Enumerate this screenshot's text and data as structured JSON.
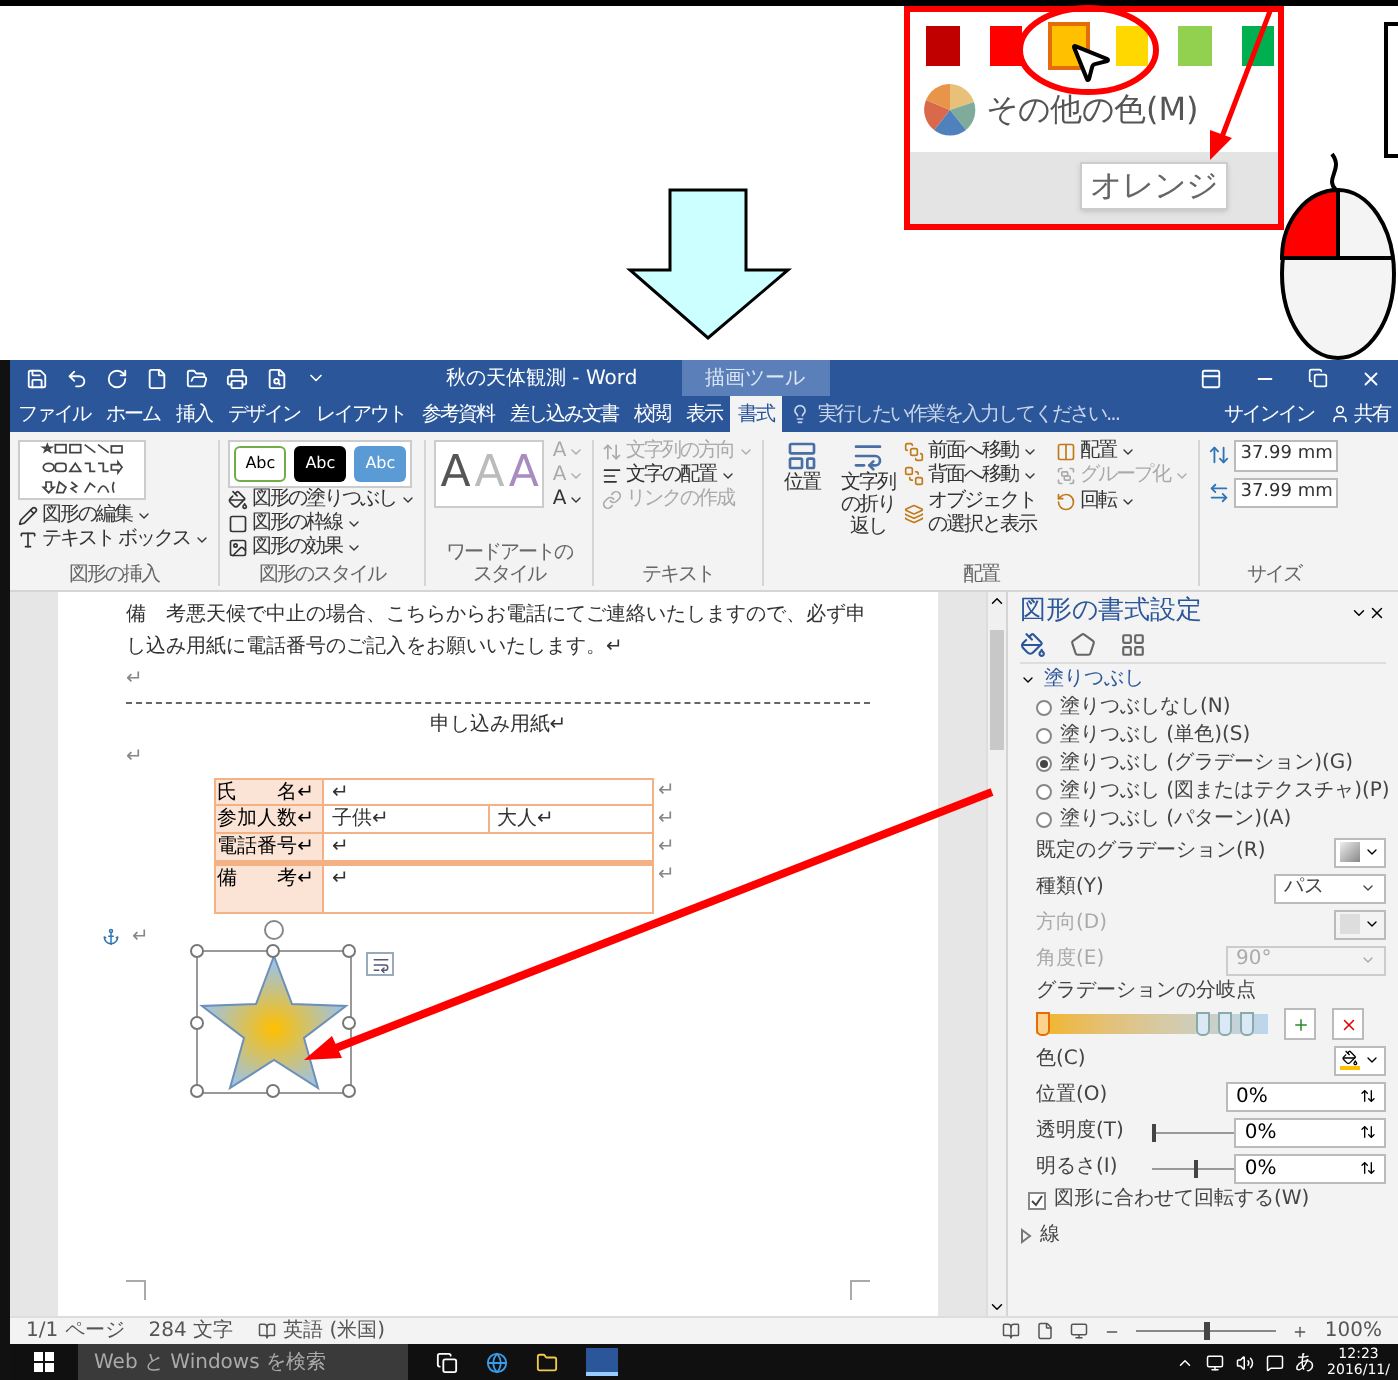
{
  "tutorial": {
    "swatches": [
      {
        "color": "#c00000",
        "selected": false
      },
      {
        "color": "#ff0000",
        "selected": false
      },
      {
        "color": "#ffc000",
        "selected": true
      },
      {
        "color": "#ffd800",
        "selected": false
      },
      {
        "color": "#92d050",
        "selected": false
      },
      {
        "color": "#00b050",
        "selected": false
      }
    ],
    "more_colors": "その他の色(M)",
    "tooltip": "オレンジ"
  },
  "word": {
    "title": "秋の天体観測 - Word",
    "context_group": "描画ツール",
    "tabs": [
      {
        "label": "ファイル",
        "selected": false
      },
      {
        "label": "ホーム",
        "selected": false
      },
      {
        "label": "挿入",
        "selected": false
      },
      {
        "label": "デザイン",
        "selected": false
      },
      {
        "label": "レイアウト",
        "selected": false
      },
      {
        "label": "参考資料",
        "selected": false
      },
      {
        "label": "差し込み文書",
        "selected": false
      },
      {
        "label": "校閲",
        "selected": false
      },
      {
        "label": "表示",
        "selected": false
      },
      {
        "label": "書式",
        "selected": true
      }
    ],
    "tell_me": "実行したい作業を入力してください...",
    "sign_in": "サインイン",
    "share": "共有",
    "ribbon": {
      "insert_shapes": {
        "label": "図形の挿入",
        "buttons": [
          "図形の編集",
          "テキスト ボックス"
        ]
      },
      "shape_styles": {
        "label": "図形のスタイル",
        "samples": [
          "Abc",
          "Abc",
          "Abc"
        ],
        "buttons": [
          "図形の塗りつぶし",
          "図形の枠線",
          "図形の効果"
        ]
      },
      "wordart": {
        "label": "ワードアートのスタイル",
        "samples": [
          "A",
          "A",
          "A"
        ],
        "buttons": [
          "A",
          "A",
          "A"
        ]
      },
      "text": {
        "label": "テキスト",
        "buttons": [
          {
            "label": "文字列の方向",
            "disabled": true
          },
          {
            "label": "文字の配置",
            "disabled": false
          },
          {
            "label": "リンクの作成",
            "disabled": true
          }
        ]
      },
      "arrange": {
        "label": "配置",
        "large": [
          "位置",
          "文字列の折り返し"
        ],
        "buttons": [
          {
            "label": "前面へ移動",
            "disabled": false
          },
          {
            "label": "配置",
            "disabled": false
          },
          {
            "label": "背面へ移動",
            "disabled": false
          },
          {
            "label": "グループ化",
            "disabled": true
          },
          {
            "label": "オブジェクトの選択と表示",
            "disabled": false
          },
          {
            "label": "回転",
            "disabled": false
          }
        ]
      },
      "size": {
        "label": "サイズ",
        "height": "37.99 mm",
        "width": "37.99 mm"
      }
    },
    "document": {
      "blocks": [
        {
          "kind": "text",
          "text": "備　考悪天候で中止の場合、こちらからお電話にてご連絡いたしますので、必ず申し込み用紙に電話番号のご記入をお願いいたします。↵"
        },
        {
          "kind": "empty",
          "text": "↵"
        },
        {
          "kind": "rule"
        },
        {
          "kind": "title",
          "text": "申し込み用紙↵"
        },
        {
          "kind": "empty",
          "text": "↵"
        },
        {
          "kind": "table",
          "rows": [
            {
              "label": "氏　　名↵",
              "cells": [
                "↵"
              ],
              "end": "↵"
            },
            {
              "label": "参加人数↵",
              "cells": [
                "子供↵",
                "大人↵"
              ],
              "end": "↵"
            },
            {
              "label": "電話番号↵",
              "cells": [
                "↵"
              ],
              "end": "↵"
            },
            {
              "label": "備　　考↵",
              "cells": [
                "↵"
              ],
              "end": "↵"
            }
          ]
        },
        {
          "kind": "anchor",
          "text": "↵"
        }
      ]
    },
    "format_pane": {
      "title": "図形の書式設定",
      "section": "塗りつぶし",
      "fill_options": [
        {
          "label": "塗りつぶしなし(N)",
          "selected": false
        },
        {
          "label": "塗りつぶし (単色)(S)",
          "selected": false
        },
        {
          "label": "塗りつぶし (グラデーション)(G)",
          "selected": true
        },
        {
          "label": "塗りつぶし (図またはテクスチャ)(P)",
          "selected": false
        },
        {
          "label": "塗りつぶし (パターン)(A)",
          "selected": false
        }
      ],
      "fields": [
        {
          "kind": "preset",
          "label": "既定のグラデーション(R)",
          "disabled": false
        },
        {
          "kind": "dropdown",
          "label": "種類(Y)",
          "value": "パス",
          "disabled": false
        },
        {
          "kind": "preset",
          "label": "方向(D)",
          "disabled": true
        },
        {
          "kind": "spin",
          "label": "角度(E)",
          "value": "90°",
          "disabled": true
        }
      ],
      "stops_label": "グラデーションの分岐点",
      "stops": [
        {
          "selected": true
        },
        {
          "selected": false
        },
        {
          "selected": false
        },
        {
          "selected": false
        }
      ],
      "color_label": "色(C)",
      "spins": [
        {
          "kind": "plain",
          "label": "位置(O)",
          "value": "0%"
        },
        {
          "kind": "slider",
          "label": "透明度(T)",
          "value": "0%",
          "level": 0
        },
        {
          "kind": "slider",
          "label": "明るさ(I)",
          "value": "0%",
          "level": 0.5
        }
      ],
      "rotate": {
        "label": "図形に合わせて回転する(W)",
        "checked": true
      },
      "line_section": "線"
    },
    "status_bar": {
      "items": [
        "1/1 ページ",
        "284 文字",
        "英語 (米国)"
      ],
      "zoom": "100%",
      "zoom_level": {
        "level": 0.5
      }
    },
    "taskbar": {
      "search_placeholder": "Web と Windows を検索",
      "ime": "あ",
      "time": "12:23",
      "date": "2016/11/"
    }
  }
}
